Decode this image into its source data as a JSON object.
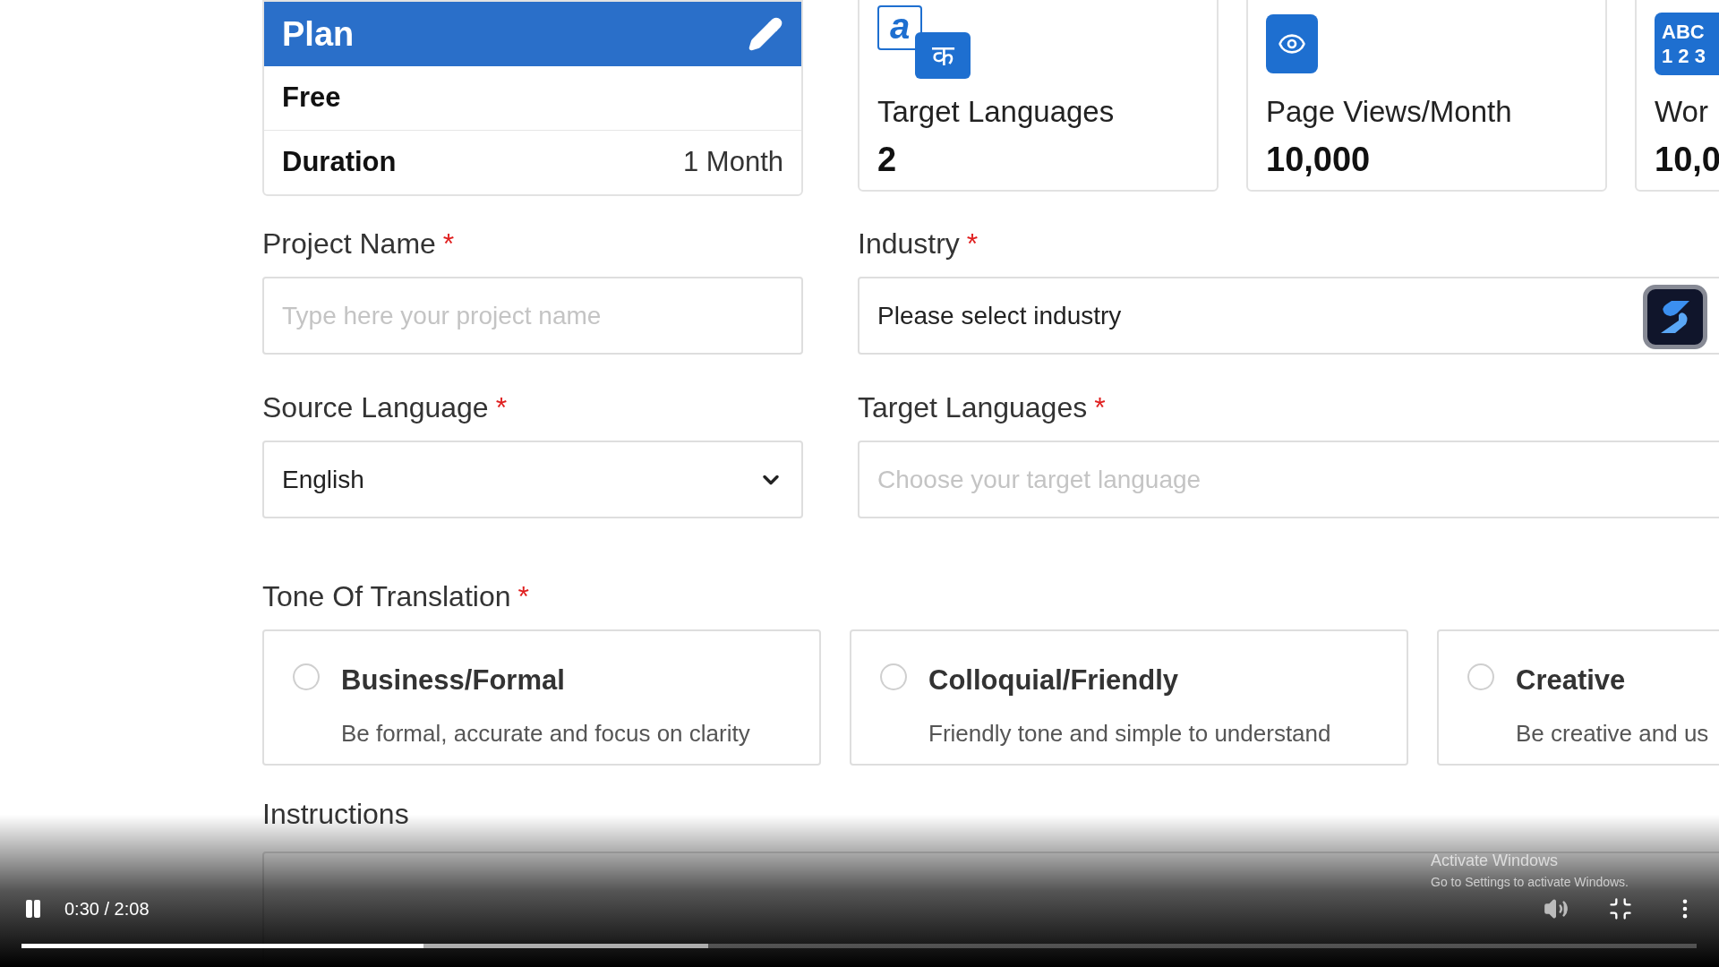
{
  "plan_card": {
    "title": "Plan",
    "plan": "Free",
    "duration_label": "Duration",
    "duration_value": "1 Month"
  },
  "stats": [
    {
      "kind": "languages",
      "icon_glyphs": [
        "a",
        "क"
      ],
      "label": "Target Languages",
      "value": "2"
    },
    {
      "kind": "views",
      "label": "Page Views/Month",
      "value": "10,000"
    },
    {
      "kind": "words",
      "icon_glyphs": [
        "ABC",
        "1 2 3"
      ],
      "label": "Wor",
      "value": "10,0"
    }
  ],
  "fields": [
    {
      "kind": "text",
      "label": "Project Name",
      "required_mark": "*",
      "placeholder": "Type here your project name"
    },
    {
      "kind": "select",
      "label": "Industry",
      "required_mark": "*",
      "value": "Please select industry"
    },
    {
      "kind": "dropdown",
      "label": "Source Language",
      "required_mark": "*",
      "value": "English"
    },
    {
      "kind": "text",
      "label": "Target Languages",
      "required_mark": "*",
      "placeholder": "Choose your target language"
    }
  ],
  "tone": {
    "label": "Tone Of Translation",
    "required_mark": "*",
    "options": [
      {
        "title": "Business/Formal",
        "description": "Be formal, accurate and focus on clarity",
        "selected": false
      },
      {
        "title": "Colloquial/Friendly",
        "description": "Friendly tone and simple to understand",
        "selected": false
      },
      {
        "title": "Creative",
        "description": "Be creative and us",
        "selected": false
      }
    ]
  },
  "instructions": {
    "label": "Instructions"
  },
  "player": {
    "playing": true,
    "time": "0:30 / 2:08",
    "progress": {
      "level": 0.24
    },
    "buffer": {
      "level": 0.41
    }
  },
  "os_notice": {
    "title": "Activate Windows",
    "subtitle": "Go to Settings to activate Windows."
  }
}
